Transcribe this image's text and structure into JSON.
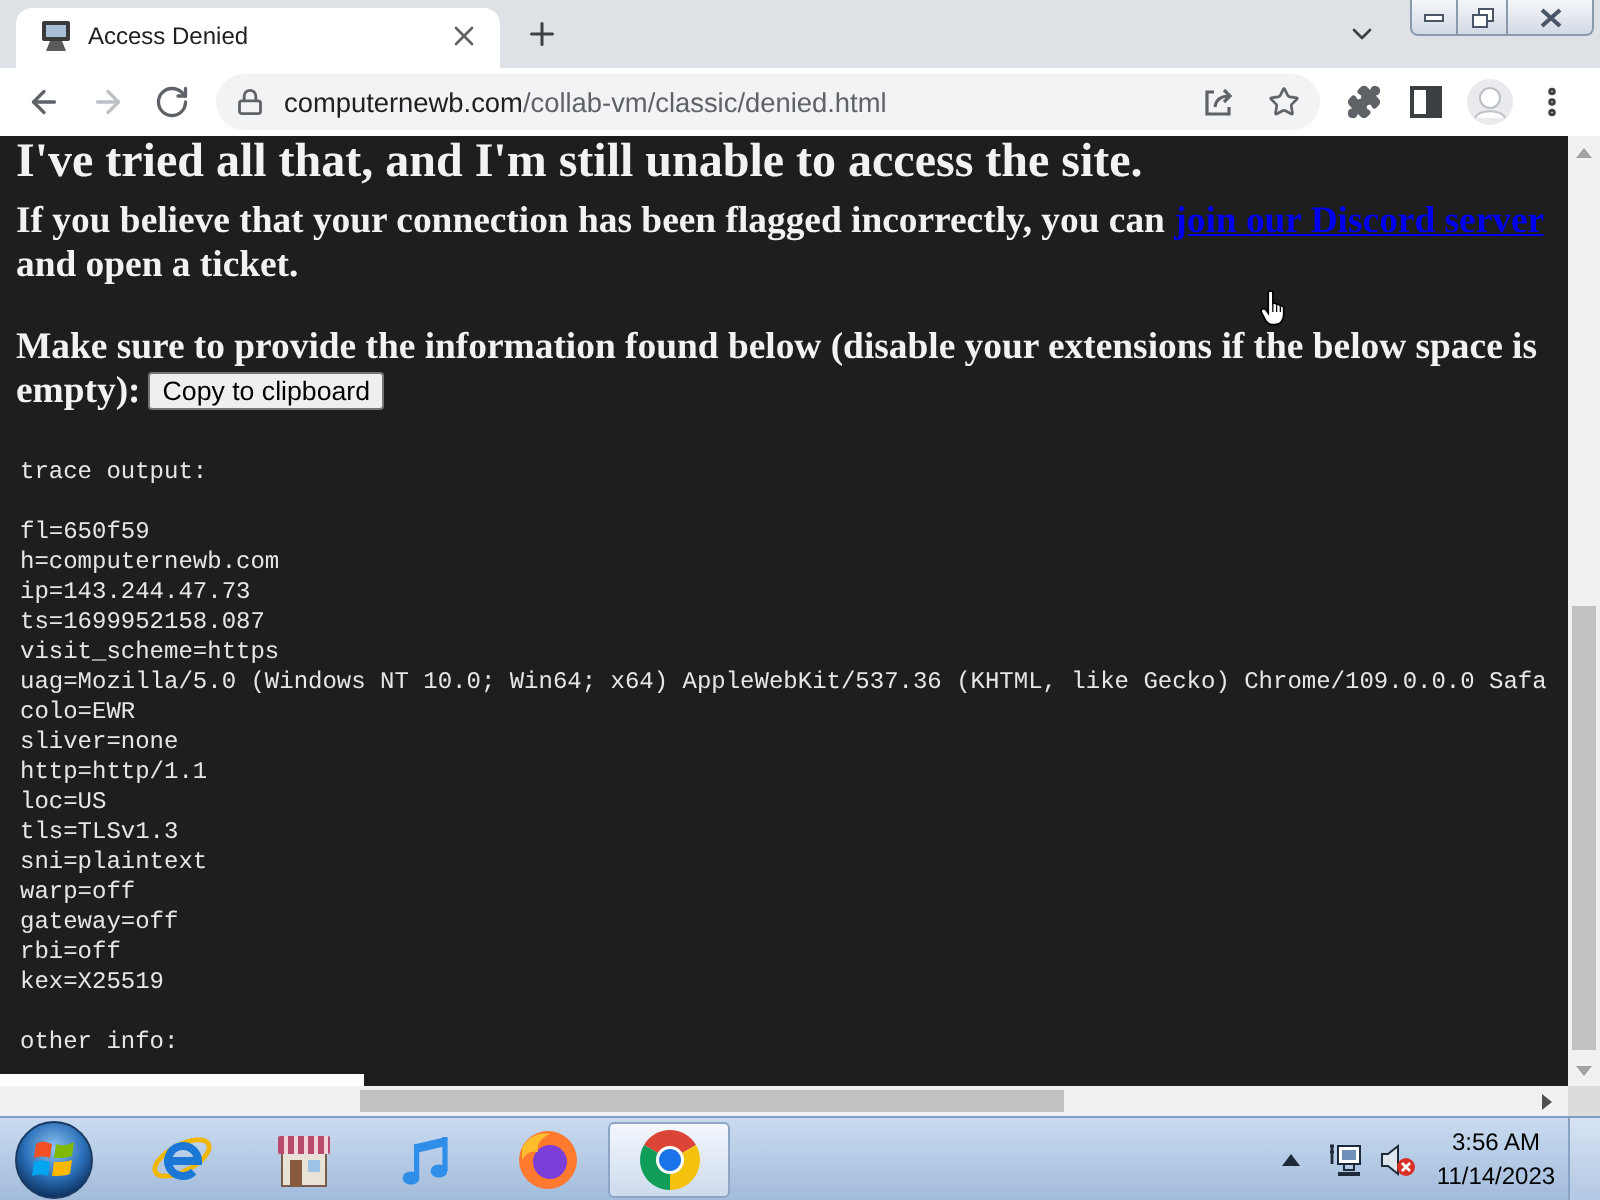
{
  "tabs": [
    {
      "title": "Access Denied",
      "selected": true
    }
  ],
  "nav_buttons": [
    {
      "kind": "back",
      "disabled": false
    },
    {
      "kind": "forward",
      "disabled": true
    },
    {
      "kind": "reload",
      "disabled": false
    }
  ],
  "address_bar": {
    "host": "computernewb.com",
    "path": "/collab-vm/classic/denied.html"
  },
  "page": {
    "heading": "I've tried all that, and I'm still unable to access the site.",
    "contact": {
      "text": "If you believe that your connection has been flagged incorrectly, you can",
      "link": "join our Discord server",
      "after": "and open a ticket."
    },
    "instructions": {
      "text": "Make sure to provide the information found below (disable your extensions if the below space is empty):",
      "button": "Copy to clipboard"
    },
    "trace": {
      "title": "trace output:",
      "lines": [
        "fl=650f59",
        "h=computernewb.com",
        "ip=143.244.47.73",
        "ts=1699952158.087",
        "visit_scheme=https",
        "uag=Mozilla/5.0 (Windows NT 10.0; Win64; x64) AppleWebKit/537.36 (KHTML, like Gecko) Chrome/109.0.0.0 Safa",
        "colo=EWR",
        "sliver=none",
        "http=http/1.1",
        "loc=US",
        "tls=TLSv1.3",
        "sni=plaintext",
        "warp=off",
        "gateway=off",
        "rbi=off",
        "kex=X25519"
      ]
    },
    "other_info": {
      "title": "other info:"
    }
  },
  "taskbar": {
    "apps": [
      {
        "kind": "ie",
        "selected": false
      },
      {
        "kind": "store",
        "selected": false
      },
      {
        "kind": "music",
        "selected": false
      },
      {
        "kind": "firefox",
        "selected": false
      },
      {
        "kind": "chrome",
        "selected": true
      }
    ],
    "tray": {
      "muted": true
    },
    "clock": {
      "time": "3:56 AM",
      "date": "11/14/2023"
    }
  }
}
